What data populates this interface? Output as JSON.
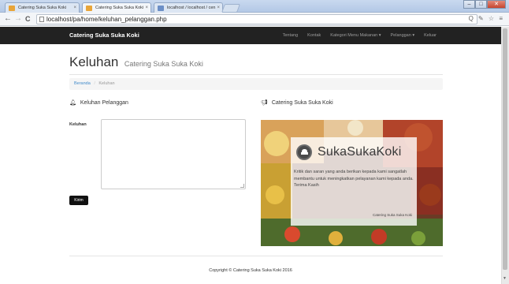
{
  "browser": {
    "tabs": [
      {
        "label": "Catering Suka Suka Koki"
      },
      {
        "label": "Catering Suka Suka Koki"
      },
      {
        "label": "localhost / localhost / cen"
      }
    ],
    "window_buttons": {
      "minimize": "–",
      "maximize": "□",
      "close": "✕"
    },
    "nav": {
      "back": "←",
      "forward": "→",
      "reload": "C"
    },
    "url": "localhost/pa/home/keluhan_pelanggan.php",
    "url_icons": "Q ✎ ☆ ≡"
  },
  "navbar": {
    "brand": "Catering Suka Suka Koki",
    "links": [
      "Tentang",
      "Kontak",
      "Kategori Menu Makanan ▾",
      "Pelanggan ▾",
      "Keluar"
    ]
  },
  "page": {
    "title": "Keluhan",
    "subtitle": "Catering Suka Suka Koki"
  },
  "breadcrumb": {
    "home": "Beranda",
    "separator": "/",
    "current": "Keluhan"
  },
  "form": {
    "heading_icon": "bell-icon",
    "heading": "Keluhan Pelanggan",
    "label": "Keluhan",
    "value": "",
    "submit_label": "Kirim"
  },
  "promo": {
    "heading_icon": "bullhorn-icon",
    "heading": "Catering Suka Suka Koki",
    "logo_text": "SukaSukaKoki",
    "message": "Kritik dan saran yang anda berikan kepada kami sangatlah membantu untuk meningkatkan pelayanan kami kepada anda.",
    "thanks": "Terima Kasih",
    "signature": "Catering Suka Suka Koki"
  },
  "footer": {
    "copyright": "Copyright © Catering Suka Suka Koki 2016"
  },
  "colors": {
    "navbar": "#222222",
    "link": "#428bca",
    "button": "#111111"
  }
}
